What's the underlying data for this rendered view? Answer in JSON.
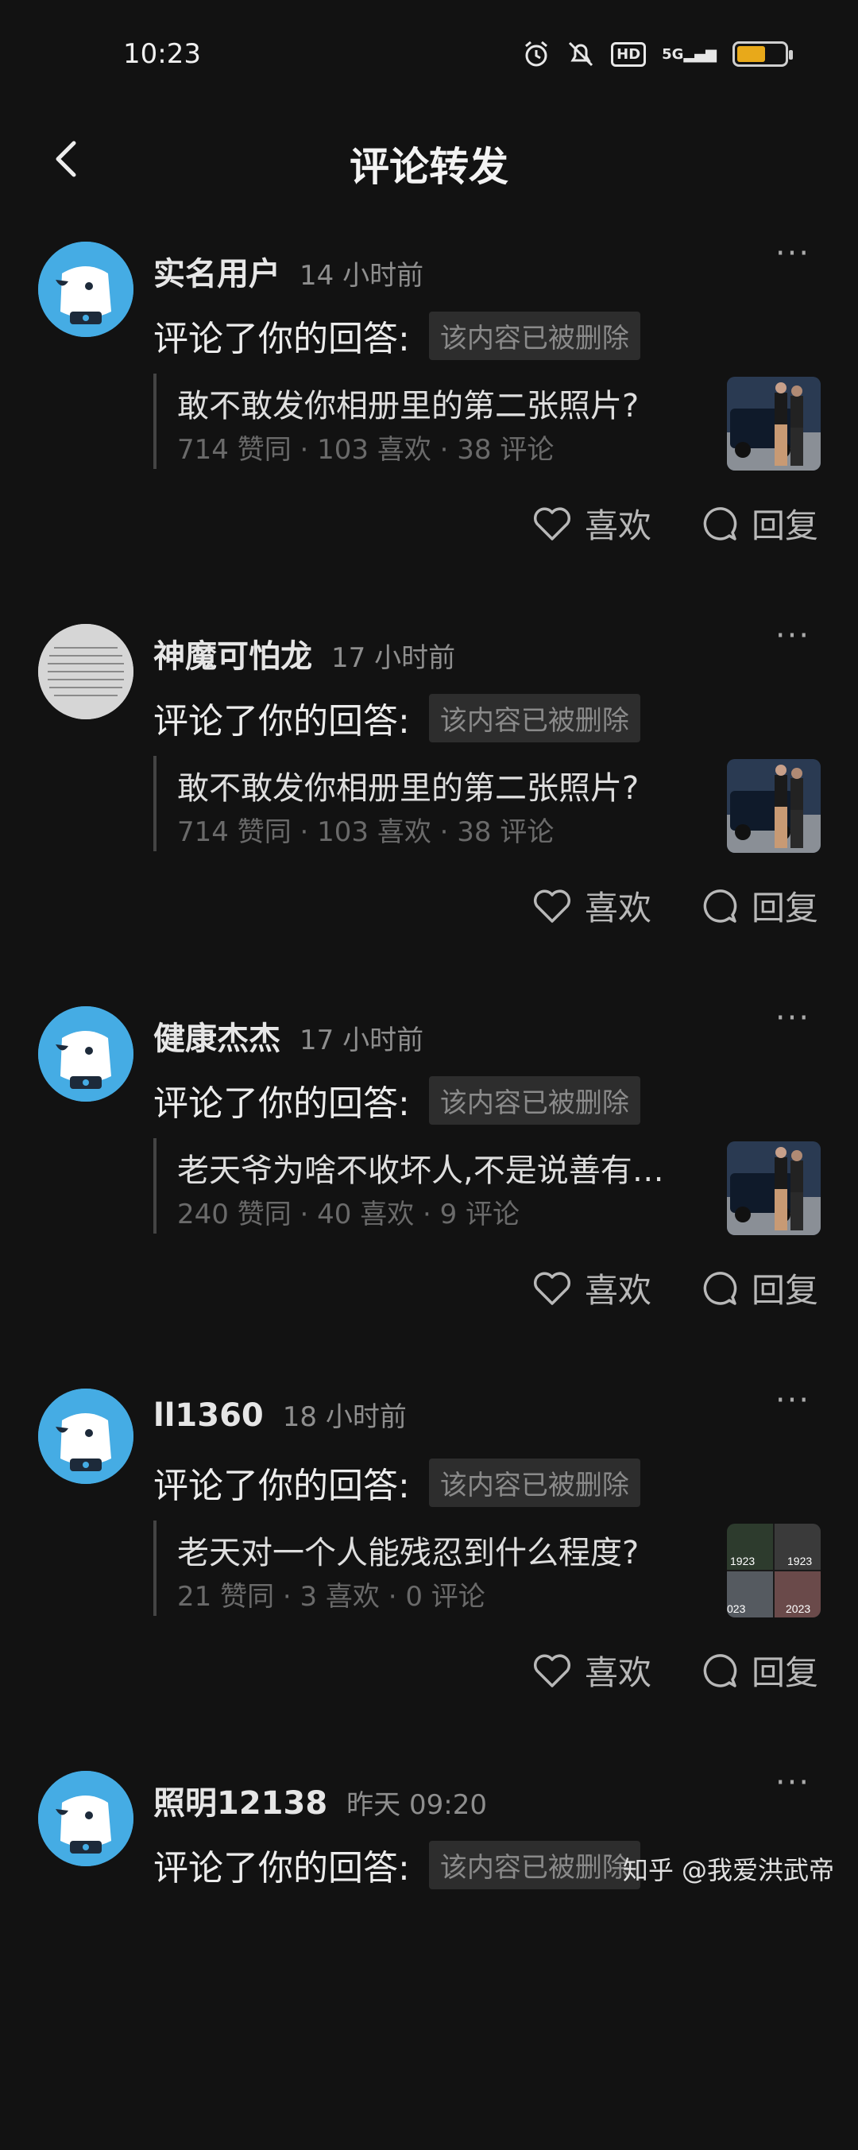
{
  "status_bar": {
    "time": "10:23",
    "hd": "HD",
    "signal": "5G"
  },
  "header": {
    "title": "评论转发"
  },
  "items": [
    {
      "username": "实名用户",
      "time": "14 小时前",
      "action": "评论了你的回答:",
      "deleted": "该内容已被删除",
      "quote_title": "敢不敢发你相册里的第二张照片?",
      "quote_stats": "714 赞同 · 103 喜欢 · 38 评论",
      "like_label": "喜欢",
      "reply_label": "回复",
      "avatar": "dog-avatar",
      "thumbnail": "car-photo"
    },
    {
      "username": "神魔可怕龙",
      "time": "17 小时前",
      "action": "评论了你的回答:",
      "deleted": "该内容已被删除",
      "quote_title": "敢不敢发你相册里的第二张照片?",
      "quote_stats": "714 赞同 · 103 喜欢 · 38 评论",
      "like_label": "喜欢",
      "reply_label": "回复",
      "avatar": "text-avatar",
      "thumbnail": "car-photo"
    },
    {
      "username": "健康杰杰",
      "time": "17 小时前",
      "action": "评论了你的回答:",
      "deleted": "该内容已被删除",
      "quote_title": "老天爷为啥不收坏人,不是说善有…",
      "quote_stats": "240 赞同 · 40 喜欢 · 9 评论",
      "like_label": "喜欢",
      "reply_label": "回复",
      "avatar": "dog-avatar",
      "thumbnail": "car-photo"
    },
    {
      "username": "ll1360",
      "time": "18 小时前",
      "action": "评论了你的回答:",
      "deleted": "该内容已被删除",
      "quote_title": "老天对一个人能残忍到什么程度?",
      "quote_stats": "21 赞同 · 3 喜欢 · 0 评论",
      "like_label": "喜欢",
      "reply_label": "回复",
      "avatar": "dog-avatar",
      "thumbnail": "collage-photo",
      "thumb_labels": [
        "1923",
        "1923",
        "023",
        "2023"
      ]
    },
    {
      "username": "照明12138",
      "time": "昨天 09:20",
      "action": "评论了你的回答:",
      "deleted": "该内容已被删除",
      "avatar": "dog-avatar"
    }
  ],
  "watermark": "知乎 @我爱洪武帝"
}
